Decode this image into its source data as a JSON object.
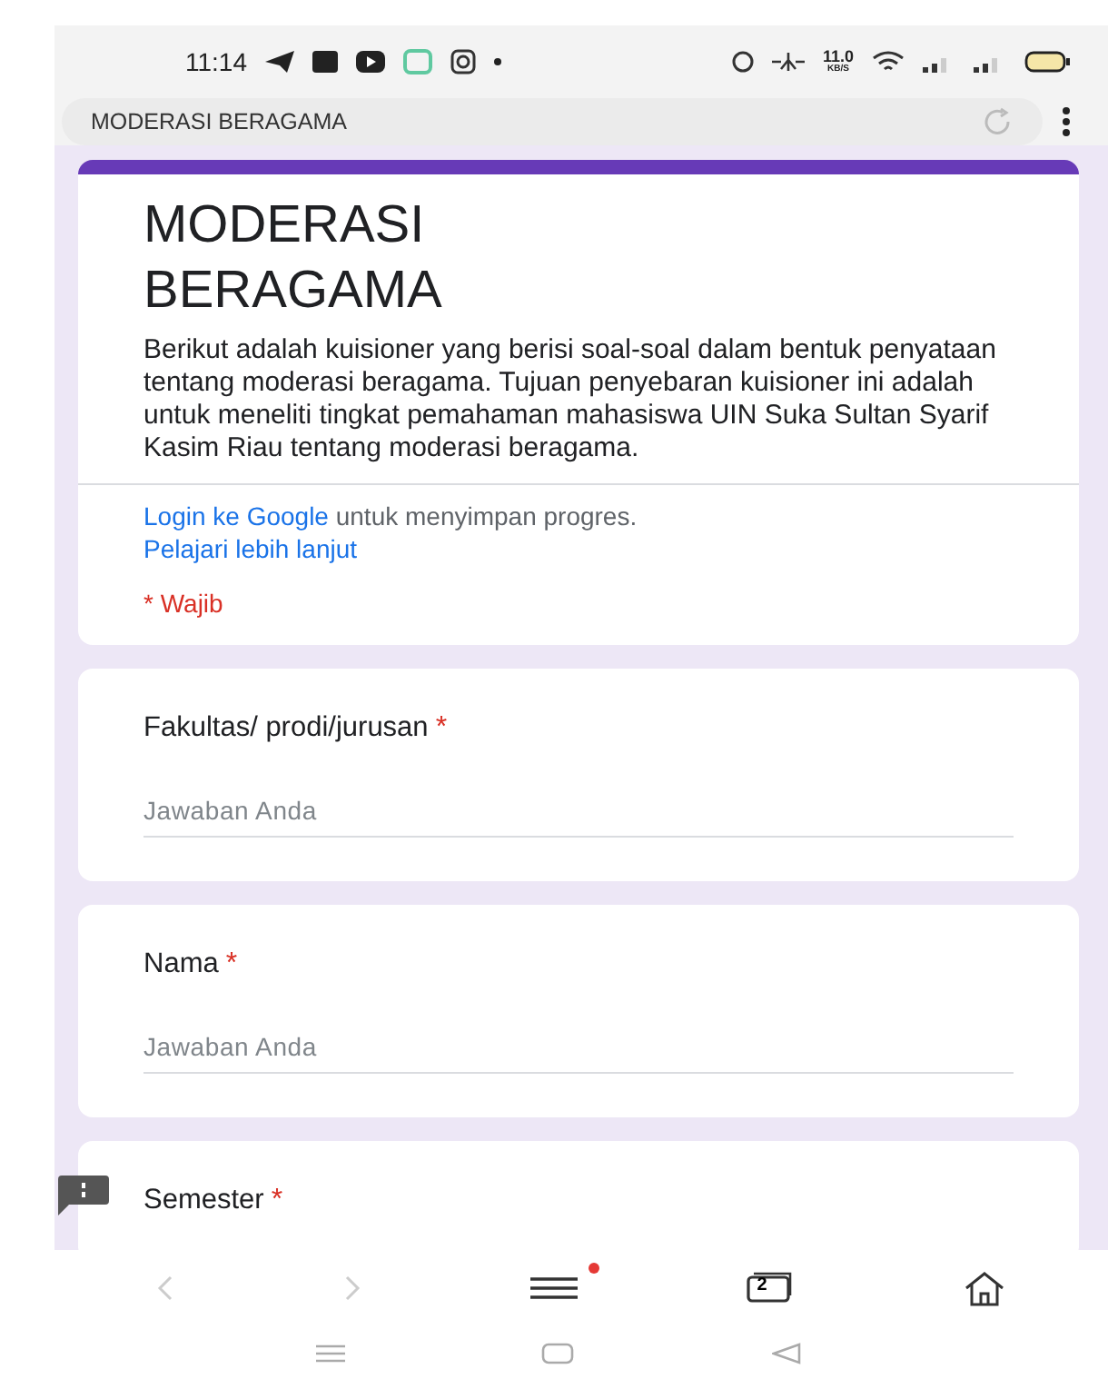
{
  "status_bar": {
    "time": "11:14",
    "net_speed": "11.0",
    "net_unit": "KB/S"
  },
  "address_bar": {
    "title": "MODERASI BERAGAMA"
  },
  "form": {
    "title": "MODERASI BERAGAMA",
    "description": "Berikut adalah kuisioner yang berisi soal-soal dalam bentuk penyataan tentang moderasi beragama. Tujuan penyebaran kuisioner ini adalah untuk meneliti tingkat pemahaman mahasiswa UIN Suka Sultan Syarif Kasim Riau tentang moderasi beragama.",
    "login_link": "Login ke Google",
    "login_text": " untuk menyimpan progres.",
    "learn_more": "Pelajari lebih lanjut",
    "required_note": "* Wajib"
  },
  "questions": [
    {
      "label": "Fakultas/ prodi/jurusan",
      "required_mark": "*",
      "placeholder": "Jawaban Anda"
    },
    {
      "label": "Nama",
      "required_mark": "*",
      "placeholder": "Jawaban Anda"
    },
    {
      "label": "Semester",
      "required_mark": "*"
    }
  ],
  "browser_toolbar": {
    "tab_count": "2",
    "menu_badge": true
  }
}
